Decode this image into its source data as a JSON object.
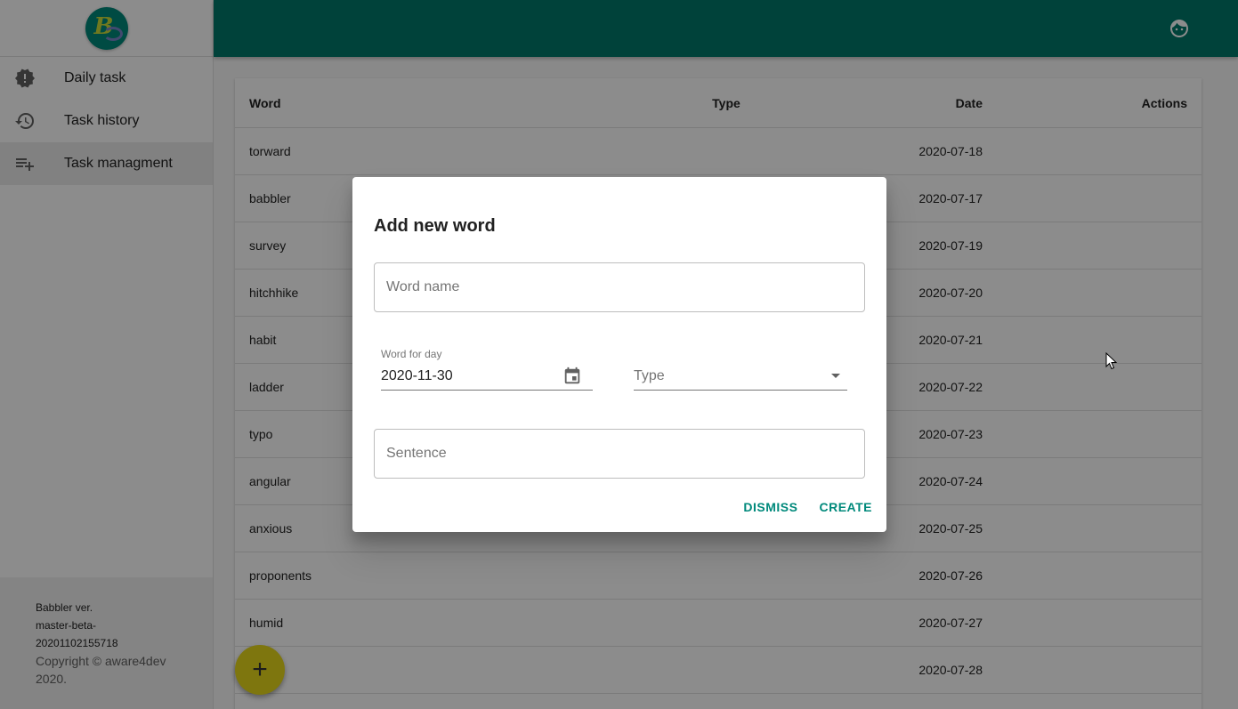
{
  "sidebar": {
    "logo_letter": "B",
    "items": [
      {
        "label": "Daily task",
        "icon": "alert-badge-icon"
      },
      {
        "label": "Task history",
        "icon": "history-icon"
      },
      {
        "label": "Task managment",
        "icon": "playlist-add-icon"
      }
    ],
    "footer": {
      "line1": "Babbler ver.",
      "line2": "master-beta-",
      "line3": "20201102155718",
      "copyright_1": "Copyright © aware4dev",
      "copyright_2": "2020."
    }
  },
  "topbar": {
    "color": "#00796b",
    "account_icon": "face-icon"
  },
  "table": {
    "headers": {
      "word": "Word",
      "type": "Type",
      "date": "Date",
      "actions": "Actions"
    },
    "rows": [
      {
        "word": "torward",
        "type": "",
        "date": "2020-07-18"
      },
      {
        "word": "babbler",
        "type": "",
        "date": "2020-07-17"
      },
      {
        "word": "survey",
        "type": "",
        "date": "2020-07-19"
      },
      {
        "word": "hitchhike",
        "type": "",
        "date": "2020-07-20"
      },
      {
        "word": "habit",
        "type": "",
        "date": "2020-07-21"
      },
      {
        "word": "ladder",
        "type": "",
        "date": "2020-07-22"
      },
      {
        "word": "typo",
        "type": "",
        "date": "2020-07-23"
      },
      {
        "word": "angular",
        "type": "",
        "date": "2020-07-24"
      },
      {
        "word": "anxious",
        "type": "",
        "date": "2020-07-25"
      },
      {
        "word": "proponents",
        "type": "",
        "date": "2020-07-26"
      },
      {
        "word": "humid",
        "type": "",
        "date": "2020-07-27"
      },
      {
        "word": "",
        "type": "",
        "date": "2020-07-28"
      }
    ]
  },
  "fab": {
    "label": "+"
  },
  "dialog": {
    "title": "Add new word",
    "word_name_placeholder": "Word name",
    "date_label": "Word for day",
    "date_value": "2020-11-30",
    "type_placeholder": "Type",
    "sentence_placeholder": "Sentence",
    "dismiss_label": "DISMISS",
    "create_label": "CREATE",
    "accent_color": "#00897b"
  }
}
